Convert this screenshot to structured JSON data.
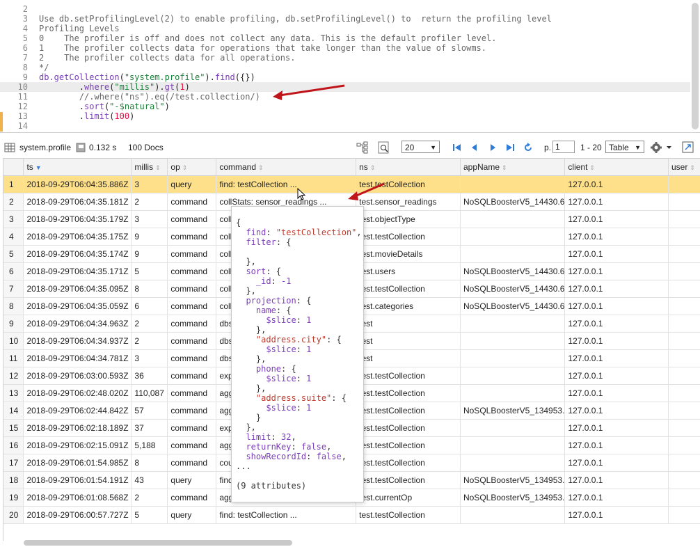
{
  "editor": {
    "lines": [
      {
        "n": "2",
        "html": ""
      },
      {
        "n": "3",
        "html": "<span class='c-com'>Use db.setProfilingLevel(2) to enable profiling, db.setProfilingLevel() to  return the profiling level</span>"
      },
      {
        "n": "4",
        "html": "<span class='c-com'>Profiling Levels</span>"
      },
      {
        "n": "5",
        "html": "<span class='c-com'>0    The profiler is off and does not collect any data. This is the default profiler level.</span>"
      },
      {
        "n": "6",
        "html": "<span class='c-com'>1    The profiler collects data for operations that take longer than the value of slowms.</span>"
      },
      {
        "n": "7",
        "html": "<span class='c-com'>2    The profiler collects data for all operations.</span>"
      },
      {
        "n": "8",
        "html": "<span class='c-com'>*/</span>"
      },
      {
        "n": "9",
        "html": "<span class='c-fn'>db.getCollection</span>(<span class='c-str'>\"system.profile\"</span>).<span class='c-fn'>find</span>({})"
      },
      {
        "n": "10",
        "html": "        .<span class='c-fn'>where</span>(<span class='c-str'>\"millis\"</span>).<span class='c-fn'>gt</span>(<span class='c-num'>1</span>)"
      },
      {
        "n": "11",
        "html": "        <span class='c-com'>//.where(\"ns\").eq(/test.collection/)</span>"
      },
      {
        "n": "12",
        "html": "        .<span class='c-fn'>sort</span>(<span class='c-str'>\"-$natural\"</span>)"
      },
      {
        "n": "13",
        "html": "        .<span class='c-fn'>limit</span>(<span class='c-num'>100</span>)"
      },
      {
        "n": "14",
        "html": ""
      }
    ],
    "active_line_index": 8
  },
  "toolbar": {
    "collection": "system.profile",
    "time": "0.132 s",
    "docs": "100 Docs",
    "page_size": "20",
    "page_label": "p.",
    "page_value": "1",
    "range": "1 - 20",
    "view_mode": "Table"
  },
  "grid": {
    "columns": [
      "ts",
      "millis",
      "op",
      "command",
      "ns",
      "appName",
      "client",
      "user"
    ],
    "sorted_column": "ts",
    "rows": [
      [
        "1",
        "2018-09-29T06:04:35.886Z",
        "3",
        "query",
        "find: testCollection ...",
        "test.testCollection",
        "",
        "127.0.0.1",
        ""
      ],
      [
        "2",
        "2018-09-29T06:04:35.181Z",
        "2",
        "command",
        "collStats: sensor_readings ...",
        "test.sensor_readings",
        "NoSQLBoosterV5_14430.6",
        "127.0.0.1",
        ""
      ],
      [
        "3",
        "2018-09-29T06:04:35.179Z",
        "3",
        "command",
        "coll",
        "test.objectType",
        "",
        "127.0.0.1",
        ""
      ],
      [
        "4",
        "2018-09-29T06:04:35.175Z",
        "9",
        "command",
        "coll",
        "test.testCollection",
        "",
        "127.0.0.1",
        ""
      ],
      [
        "5",
        "2018-09-29T06:04:35.174Z",
        "9",
        "command",
        "coll",
        "test.movieDetails",
        "",
        "127.0.0.1",
        ""
      ],
      [
        "6",
        "2018-09-29T06:04:35.171Z",
        "5",
        "command",
        "coll",
        "test.users",
        "NoSQLBoosterV5_14430.6",
        "127.0.0.1",
        ""
      ],
      [
        "7",
        "2018-09-29T06:04:35.095Z",
        "8",
        "command",
        "coll",
        "test.testCollection",
        "NoSQLBoosterV5_14430.6",
        "127.0.0.1",
        ""
      ],
      [
        "8",
        "2018-09-29T06:04:35.059Z",
        "6",
        "command",
        "coll",
        "test.categories",
        "NoSQLBoosterV5_14430.6",
        "127.0.0.1",
        ""
      ],
      [
        "9",
        "2018-09-29T06:04:34.963Z",
        "2",
        "command",
        "dbs",
        "test",
        "",
        "127.0.0.1",
        ""
      ],
      [
        "10",
        "2018-09-29T06:04:34.937Z",
        "2",
        "command",
        "dbs",
        "test",
        "",
        "127.0.0.1",
        ""
      ],
      [
        "11",
        "2018-09-29T06:04:34.781Z",
        "3",
        "command",
        "dbs",
        "test",
        "",
        "127.0.0.1",
        ""
      ],
      [
        "12",
        "2018-09-29T06:03:00.593Z",
        "36",
        "command",
        "exp",
        "test.testCollection",
        "",
        "127.0.0.1",
        ""
      ],
      [
        "13",
        "2018-09-29T06:02:48.020Z",
        "110,087",
        "command",
        "agg",
        "test.testCollection",
        "",
        "127.0.0.1",
        ""
      ],
      [
        "14",
        "2018-09-29T06:02:44.842Z",
        "57",
        "command",
        "agg",
        "test.testCollection",
        "NoSQLBoosterV5_134953.",
        "127.0.0.1",
        ""
      ],
      [
        "15",
        "2018-09-29T06:02:18.189Z",
        "37",
        "command",
        "exp",
        "test.testCollection",
        "",
        "127.0.0.1",
        ""
      ],
      [
        "16",
        "2018-09-29T06:02:15.091Z",
        "5,188",
        "command",
        "agg",
        "test.testCollection",
        "",
        "127.0.0.1",
        ""
      ],
      [
        "17",
        "2018-09-29T06:01:54.985Z",
        "8",
        "command",
        "cou",
        "test.testCollection",
        "",
        "127.0.0.1",
        ""
      ],
      [
        "18",
        "2018-09-29T06:01:54.191Z",
        "43",
        "query",
        "find",
        "test.testCollection",
        "NoSQLBoosterV5_134953.",
        "127.0.0.1",
        ""
      ],
      [
        "19",
        "2018-09-29T06:01:08.568Z",
        "2",
        "command",
        "agg",
        "test.currentOp",
        "NoSQLBoosterV5_134953.",
        "127.0.0.1",
        ""
      ],
      [
        "20",
        "2018-09-29T06:00:57.727Z",
        "5",
        "query",
        "find: testCollection ...",
        "test.testCollection",
        "",
        "127.0.0.1",
        ""
      ]
    ]
  },
  "popup": {
    "lines": [
      "{",
      "  <span class='pk'>find</span>: <span class='ps'>\"testCollection\"</span>,",
      "  <span class='pk'>filter</span>: {",
      "",
      "  },",
      "  <span class='pk'>sort</span>: {",
      "    <span class='pk'>_id</span>: <span class='pn'>-1</span>",
      "  },",
      "  <span class='pk'>projection</span>: {",
      "    <span class='pk'>name</span>: {",
      "      <span class='pk'>$slice</span>: <span class='pn'>1</span>",
      "    },",
      "    <span class='ps'>\"address.city\"</span>: {",
      "      <span class='pk'>$slice</span>: <span class='pn'>1</span>",
      "    },",
      "    <span class='pk'>phone</span>: {",
      "      <span class='pk'>$slice</span>: <span class='pn'>1</span>",
      "    },",
      "    <span class='ps'>\"address.suite\"</span>: {",
      "      <span class='pk'>$slice</span>: <span class='pn'>1</span>",
      "    }",
      "  },",
      "  <span class='pk'>limit</span>: <span class='pn'>32</span>,",
      "  <span class='pk'>returnKey</span>: <span class='pf'>false</span>,",
      "  <span class='pk'>showRecordId</span>: <span class='pf'>false</span>,",
      "..."
    ],
    "footer": "(9 attributes)"
  },
  "colors": {
    "selected_row": "#ffe08a",
    "annotation_arrow": "#c0161b",
    "nav_blue": "#2f7bd6"
  }
}
